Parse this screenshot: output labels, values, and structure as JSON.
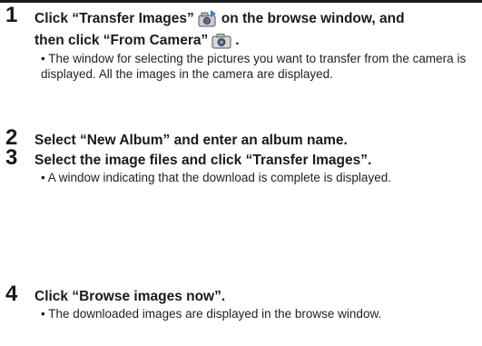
{
  "steps": [
    {
      "number": "1",
      "title_part1": "Click “Transfer Images”",
      "title_part2": "on the browse window, and",
      "title_part3": "then click “From Camera”",
      "title_part4": ".",
      "bullet": "• The window for selecting the pictures you want to transfer from the camera is displayed. All the images in the camera are displayed."
    },
    {
      "number": "2",
      "title": "Select “New Album” and enter an album name."
    },
    {
      "number": "3",
      "title": "Select the image files and click “Transfer Images”.",
      "bullet": "• A window indicating that the download is complete is displayed."
    },
    {
      "number": "4",
      "title": "Click “Browse images now”.",
      "bullet": "• The downloaded images are displayed in the browse window."
    }
  ],
  "icons": {
    "transfer_images": "transfer-images-icon",
    "from_camera": "from-camera-icon"
  }
}
